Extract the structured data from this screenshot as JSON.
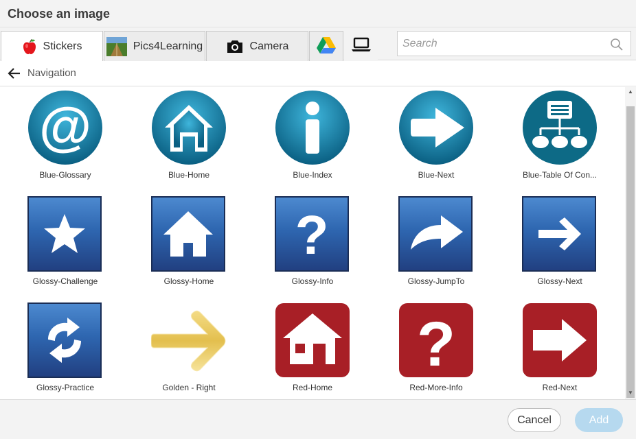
{
  "dialog": {
    "title": "Choose an image"
  },
  "tabs": [
    {
      "label": "Stickers",
      "active": true
    },
    {
      "label": "Pics4Learning",
      "active": false
    },
    {
      "label": "Camera",
      "active": false
    },
    {
      "label": "",
      "icon": "google-drive-icon"
    },
    {
      "label": "",
      "icon": "laptop-icon"
    }
  ],
  "search": {
    "placeholder": "Search",
    "value": ""
  },
  "nav": {
    "label": "Navigation"
  },
  "grid": {
    "items": [
      {
        "label": "Blue-Glossary",
        "icon": "at-sign"
      },
      {
        "label": "Blue-Home",
        "icon": "house"
      },
      {
        "label": "Blue-Index",
        "icon": "info"
      },
      {
        "label": "Blue-Next",
        "icon": "arrow-right"
      },
      {
        "label": "Blue-Table Of Con...",
        "icon": "org-chart"
      },
      {
        "label": "Glossy-Challenge",
        "icon": "star"
      },
      {
        "label": "Glossy-Home",
        "icon": "house"
      },
      {
        "label": "Glossy-Info",
        "icon": "question"
      },
      {
        "label": "Glossy-JumpTo",
        "icon": "curved-arrow"
      },
      {
        "label": "Glossy-Next",
        "icon": "arrow-right"
      },
      {
        "label": "Glossy-Practice",
        "icon": "refresh"
      },
      {
        "label": "Golden - Right",
        "icon": "golden-arrow"
      },
      {
        "label": "Red-Home",
        "icon": "house"
      },
      {
        "label": "Red-More-Info",
        "icon": "question"
      },
      {
        "label": "Red-Next",
        "icon": "arrow-right"
      }
    ]
  },
  "footer": {
    "cancel_label": "Cancel",
    "add_label": "Add"
  },
  "colors": {
    "blue_circle": "#1a8fb5",
    "blue_square": "#2e5ea8",
    "red_square": "#a81f26",
    "gold": "#e8c964",
    "add_button": "#b6d9ef"
  }
}
